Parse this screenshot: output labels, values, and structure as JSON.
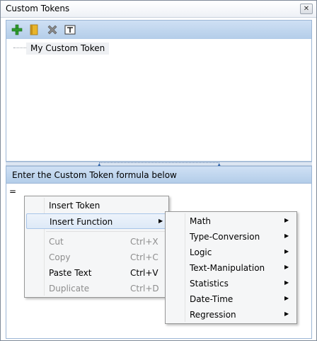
{
  "window": {
    "title": "Custom Tokens",
    "close_glyph": "✕"
  },
  "toolbar": {
    "buttons": [
      {
        "name": "add-token-button",
        "icon": "plus-icon"
      },
      {
        "name": "edit-token-button",
        "icon": "document-icon"
      },
      {
        "name": "delete-token-button",
        "icon": "x-icon"
      },
      {
        "name": "rename-token-button",
        "icon": "text-icon"
      }
    ],
    "colors": {
      "plus": "#2e9b2e",
      "document": "#d6a21c",
      "x": "#7d7d7d",
      "text": "#2b2b2b"
    }
  },
  "tree": {
    "items": [
      {
        "label": "My Custom Token"
      }
    ]
  },
  "formula": {
    "header": "Enter the Custom Token formula below",
    "value": "="
  },
  "context_menu": {
    "items": [
      {
        "label": "Insert Token",
        "shortcut": "",
        "disabled": false
      },
      {
        "label": "Insert Function",
        "shortcut": "",
        "disabled": false,
        "submenu": true,
        "active": true
      },
      {
        "label": "Cut",
        "shortcut": "Ctrl+X",
        "disabled": true
      },
      {
        "label": "Copy",
        "shortcut": "Ctrl+C",
        "disabled": true
      },
      {
        "label": "Paste Text",
        "shortcut": "Ctrl+V",
        "disabled": false
      },
      {
        "label": "Duplicate",
        "shortcut": "Ctrl+D",
        "disabled": true
      }
    ],
    "arrow_glyph": "▶"
  },
  "function_menu": {
    "items": [
      {
        "label": "Math"
      },
      {
        "label": "Type-Conversion"
      },
      {
        "label": "Logic"
      },
      {
        "label": "Text-Manipulation"
      },
      {
        "label": "Statistics"
      },
      {
        "label": "Date-Time"
      },
      {
        "label": "Regression"
      }
    ]
  }
}
